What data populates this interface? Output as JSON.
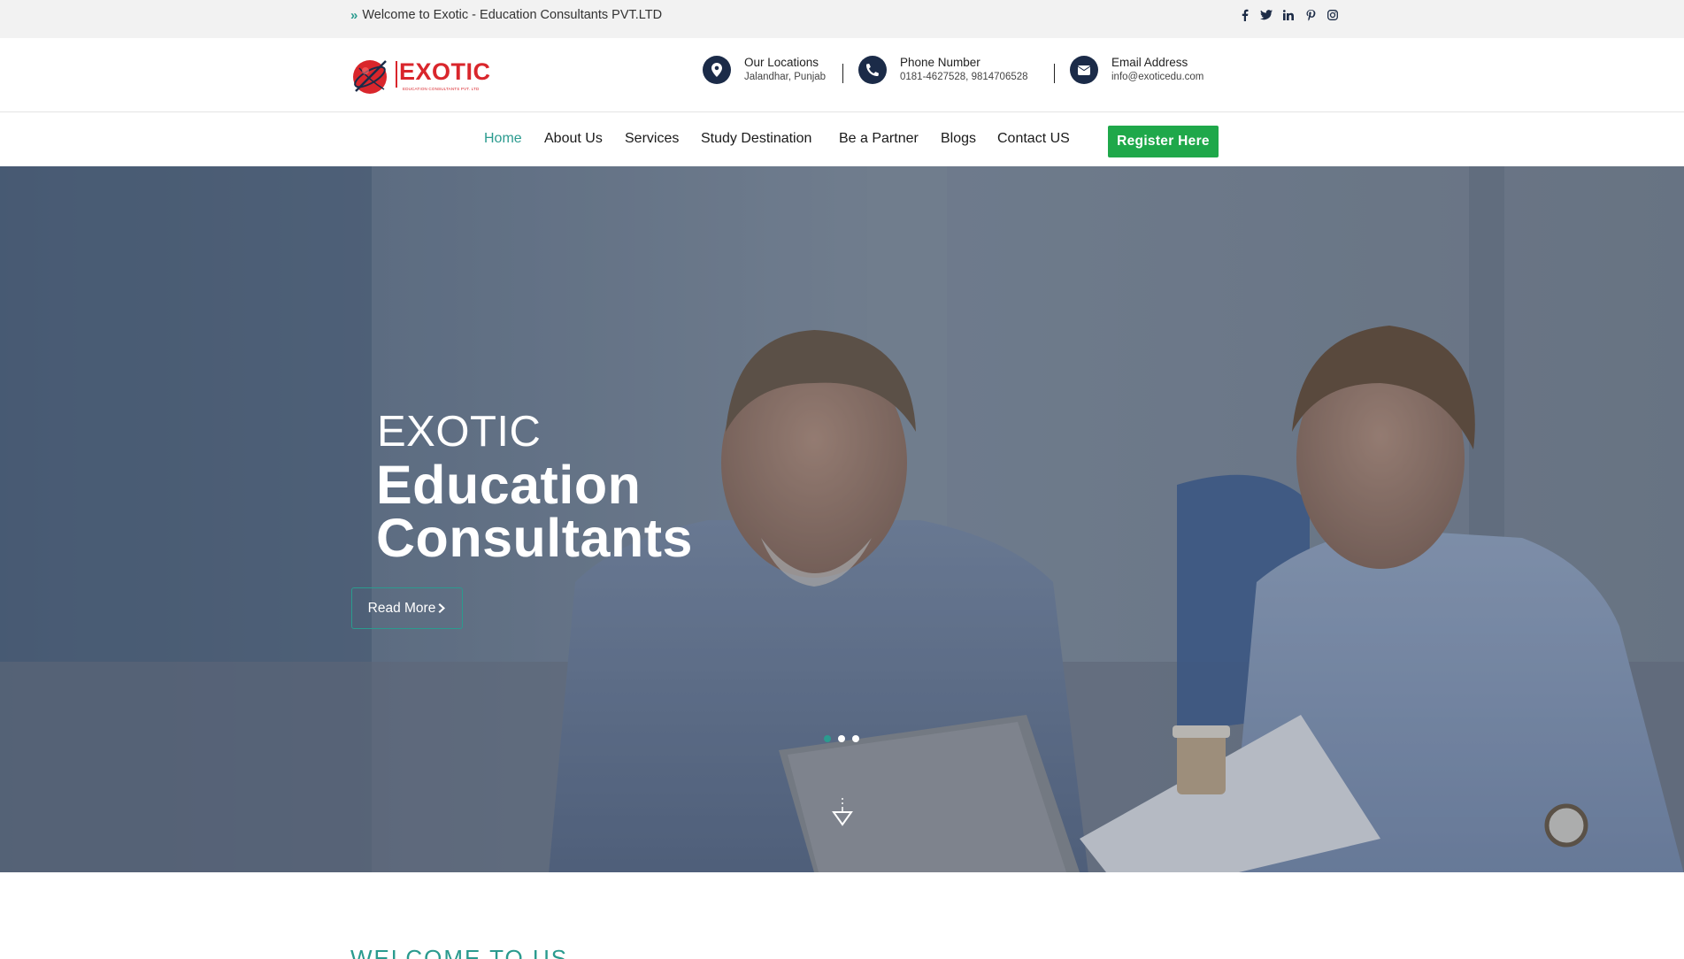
{
  "topbar": {
    "welcome_text": "Welcome to Exotic - Education Consultants PVT.LTD",
    "social": [
      {
        "icon": "facebook-icon",
        "glyph": "f"
      },
      {
        "icon": "twitter-icon",
        "glyph": "t"
      },
      {
        "icon": "linkedin-icon",
        "glyph": "in"
      },
      {
        "icon": "pinterest-icon",
        "glyph": "p"
      },
      {
        "icon": "instagram-icon",
        "glyph": "ig"
      }
    ]
  },
  "header": {
    "logo_text": "EXOTIC",
    "logo_tagline": "EDUCATION CONSULTANTS PVT. LTD",
    "location": {
      "title": "Our Locations",
      "value": "Jalandhar, Punjab",
      "icon": "map-pin-icon"
    },
    "phone": {
      "title": "Phone Number",
      "value": "0181-4627528, 9814706528",
      "icon": "phone-icon"
    },
    "email": {
      "title": "Email Address",
      "value": "info@exoticedu.com",
      "icon": "envelope-icon"
    }
  },
  "nav": {
    "items": [
      {
        "label": "Home",
        "active": true
      },
      {
        "label": "About Us"
      },
      {
        "label": "Services"
      },
      {
        "label": "Study Destination"
      },
      {
        "label": "Be a Partner"
      },
      {
        "label": "Blogs"
      },
      {
        "label": "Contact US"
      }
    ],
    "cta_label": "Register Here"
  },
  "hero": {
    "subtitle": "EXOTIC",
    "title_line1": "Education",
    "title_line2": "Consultants",
    "button_label": "Read More",
    "slides_count": 3,
    "active_slide": 1
  },
  "section": {
    "heading_peek": "WELCOME TO US"
  },
  "colors": {
    "accent": "#2b9b8f",
    "navy": "#1b2b48",
    "cta_green": "#1fa84a",
    "logo_red": "#d9262c"
  }
}
